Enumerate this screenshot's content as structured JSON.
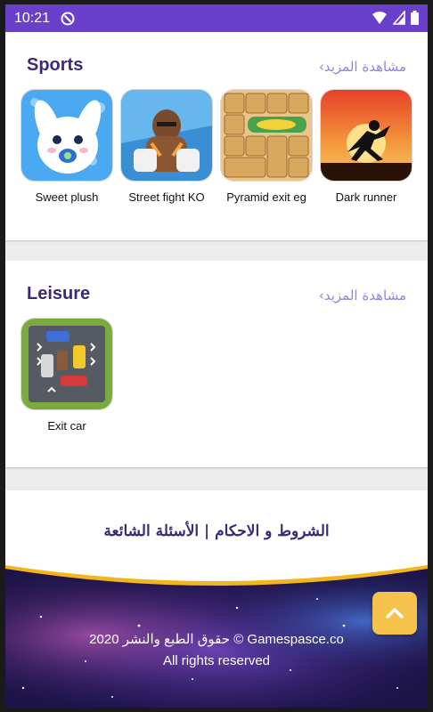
{
  "status": {
    "time": "10:21"
  },
  "sections": [
    {
      "title": "Sports",
      "see_more": "مشاهدة المزيد›",
      "games": [
        {
          "label": "Sweet plush"
        },
        {
          "label": "Street fight KO"
        },
        {
          "label": "Pyramid exit eg"
        },
        {
          "label": "Dark runner"
        }
      ]
    },
    {
      "title": "Leisure",
      "see_more": "مشاهدة المزيد›",
      "games": [
        {
          "label": "Exit car"
        }
      ]
    }
  ],
  "footer": {
    "links": "الشروط و الاحكام | الأسئلة الشائعة",
    "copyright_line1": "2020 حقوق الطبع والنشر © Gamespasce.co",
    "copyright_line2": "All rights reserved"
  },
  "colors": {
    "status_bar": "#6a3fc9",
    "title": "#3c2a78",
    "see_more": "#8f86d6",
    "scroll_top": "#f5c24c",
    "footer_wave": "#f2b51c"
  },
  "icons": {
    "status_app": "at-sign-icon",
    "wifi": "wifi-icon",
    "signal": "signal-icon",
    "battery": "battery-icon",
    "scroll_top": "chevron-up-icon"
  }
}
